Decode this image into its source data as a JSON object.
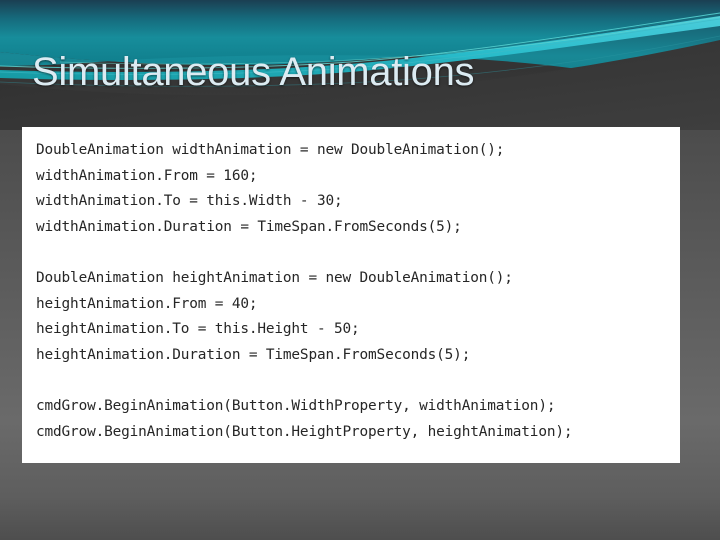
{
  "slide": {
    "title": "Simultaneous Animations",
    "title_color": "#dcebf2",
    "panel_bg": "#ffffff",
    "accent_teal": "#1a8f9e",
    "accent_cyan": "#36c8d8",
    "background_gray": "#5a5a5a"
  },
  "code": {
    "lines": [
      "DoubleAnimation widthAnimation = new DoubleAnimation();",
      "widthAnimation.From = 160;",
      "widthAnimation.To = this.Width - 30;",
      "widthAnimation.Duration = TimeSpan.FromSeconds(5);",
      "",
      "DoubleAnimation heightAnimation = new DoubleAnimation();",
      "heightAnimation.From = 40;",
      "heightAnimation.To = this.Height - 50;",
      "heightAnimation.Duration = TimeSpan.FromSeconds(5);",
      "",
      "cmdGrow.BeginAnimation(Button.WidthProperty, widthAnimation);",
      "cmdGrow.BeginAnimation(Button.HeightProperty, heightAnimation);"
    ]
  }
}
